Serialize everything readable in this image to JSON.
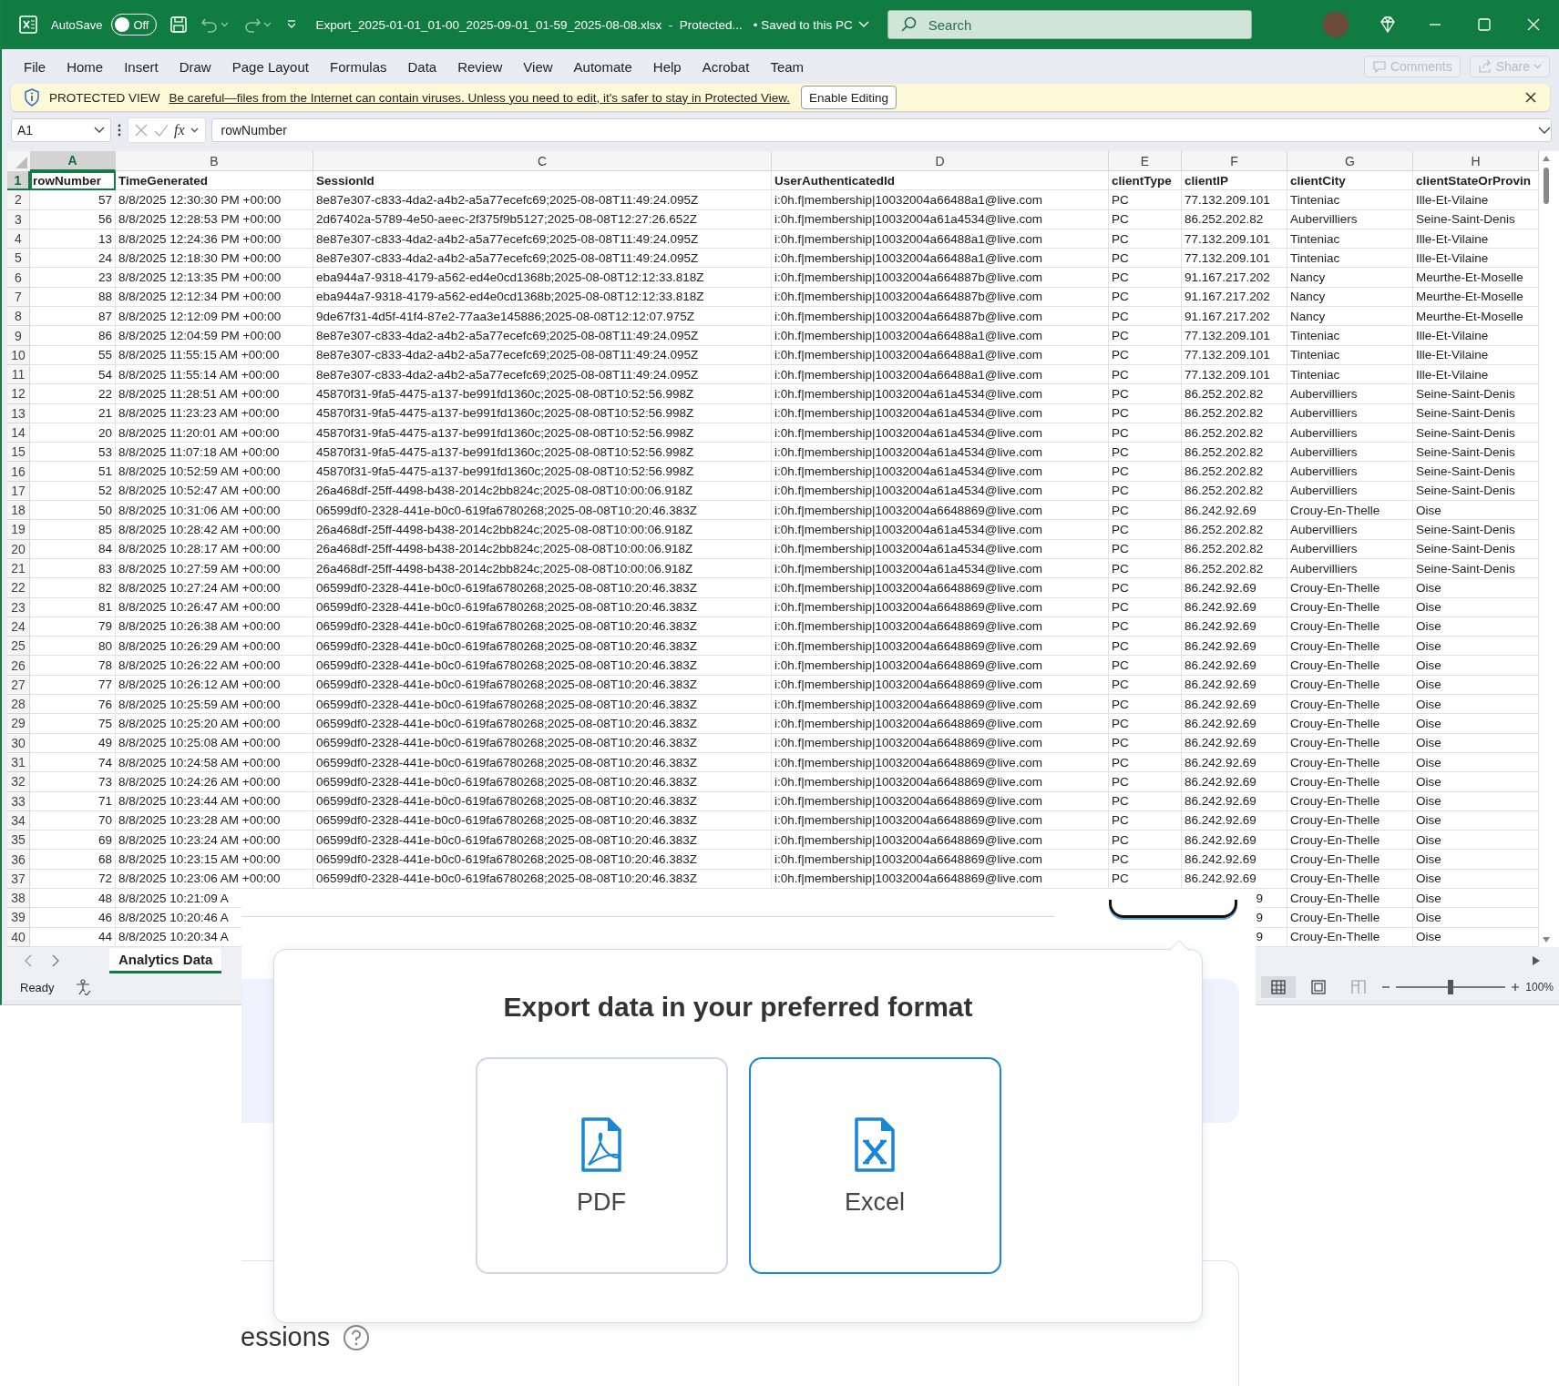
{
  "title_bar": {
    "autosave_label": "AutoSave",
    "autosave": {
      "on": false,
      "label": "Off"
    },
    "file_title": "Export_2025-01-01_01-00_2025-09-01_01-59_2025-08-08.xlsx  -  Protected...",
    "save_status": "• Saved to this PC",
    "search": {
      "placeholder": "Search"
    }
  },
  "menu": [
    "File",
    "Home",
    "Insert",
    "Draw",
    "Page Layout",
    "Formulas",
    "Data",
    "Review",
    "View",
    "Automate",
    "Help",
    "Acrobat",
    "Team"
  ],
  "menu_actions": [
    {
      "kind": "comments",
      "label": "Comments",
      "disabled": true
    },
    {
      "kind": "share",
      "label": "Share",
      "disabled": true
    }
  ],
  "protected_view": {
    "label": "PROTECTED VIEW",
    "message": "Be careful—files from the Internet can contain viruses. Unless you need to edit, it's safer to stay in Protected View.",
    "button": "Enable Editing"
  },
  "formula_bar": {
    "name_box": "A1",
    "function_label": "fx",
    "formula": "rowNumber"
  },
  "sheet": {
    "columns": [
      {
        "label": "A",
        "selected": true
      },
      {
        "label": "B",
        "selected": false
      },
      {
        "label": "C",
        "selected": false
      },
      {
        "label": "D",
        "selected": false
      },
      {
        "label": "E",
        "selected": false
      },
      {
        "label": "F",
        "selected": false
      },
      {
        "label": "G",
        "selected": false
      },
      {
        "label": "H",
        "selected": false
      }
    ],
    "rows": [
      {
        "number": "1",
        "selected": true,
        "cells": [
          "rowNumber",
          "TimeGenerated",
          "SessionId",
          "UserAuthenticatedId",
          "clientType",
          "clientIP",
          "clientCity",
          "clientStateOrProvin"
        ]
      },
      {
        "number": "2",
        "selected": false,
        "cells": [
          "57",
          "8/8/2025 12:30:30 PM +00:00",
          "8e87e307-c833-4da2-a4b2-a5a77ecefc69;2025-08-08T11:49:24.095Z",
          "i:0h.f|membership|10032004a66488a1@live.com",
          "PC",
          "77.132.209.101",
          "Tinteniac",
          "Ille-Et-Vilaine"
        ]
      },
      {
        "number": "3",
        "selected": false,
        "cells": [
          "56",
          "8/8/2025 12:28:53 PM +00:00",
          "2d67402a-5789-4e50-aeec-2f375f9b5127;2025-08-08T12:27:26.652Z",
          "i:0h.f|membership|10032004a61a4534@live.com",
          "PC",
          "86.252.202.82",
          "Aubervilliers",
          "Seine-Saint-Denis"
        ]
      },
      {
        "number": "4",
        "selected": false,
        "cells": [
          "13",
          "8/8/2025 12:24:36 PM +00:00",
          "8e87e307-c833-4da2-a4b2-a5a77ecefc69;2025-08-08T11:49:24.095Z",
          "i:0h.f|membership|10032004a66488a1@live.com",
          "PC",
          "77.132.209.101",
          "Tinteniac",
          "Ille-Et-Vilaine"
        ]
      },
      {
        "number": "5",
        "selected": false,
        "cells": [
          "24",
          "8/8/2025 12:18:30 PM +00:00",
          "8e87e307-c833-4da2-a4b2-a5a77ecefc69;2025-08-08T11:49:24.095Z",
          "i:0h.f|membership|10032004a66488a1@live.com",
          "PC",
          "77.132.209.101",
          "Tinteniac",
          "Ille-Et-Vilaine"
        ]
      },
      {
        "number": "6",
        "selected": false,
        "cells": [
          "23",
          "8/8/2025 12:13:35 PM +00:00",
          "eba944a7-9318-4179-a562-ed4e0cd1368b;2025-08-08T12:12:33.818Z",
          "i:0h.f|membership|10032004a664887b@live.com",
          "PC",
          "91.167.217.202",
          "Nancy",
          "Meurthe-Et-Moselle"
        ]
      },
      {
        "number": "7",
        "selected": false,
        "cells": [
          "88",
          "8/8/2025 12:12:34 PM +00:00",
          "eba944a7-9318-4179-a562-ed4e0cd1368b;2025-08-08T12:12:33.818Z",
          "i:0h.f|membership|10032004a664887b@live.com",
          "PC",
          "91.167.217.202",
          "Nancy",
          "Meurthe-Et-Moselle"
        ]
      },
      {
        "number": "8",
        "selected": false,
        "cells": [
          "87",
          "8/8/2025 12:12:09 PM +00:00",
          "9de67f31-4d5f-41f4-87e2-77aa3e145886;2025-08-08T12:12:07.975Z",
          "i:0h.f|membership|10032004a664887b@live.com",
          "PC",
          "91.167.217.202",
          "Nancy",
          "Meurthe-Et-Moselle"
        ]
      },
      {
        "number": "9",
        "selected": false,
        "cells": [
          "86",
          "8/8/2025 12:04:59 PM +00:00",
          "8e87e307-c833-4da2-a4b2-a5a77ecefc69;2025-08-08T11:49:24.095Z",
          "i:0h.f|membership|10032004a66488a1@live.com",
          "PC",
          "77.132.209.101",
          "Tinteniac",
          "Ille-Et-Vilaine"
        ]
      },
      {
        "number": "10",
        "selected": false,
        "cells": [
          "55",
          "8/8/2025 11:55:15 AM +00:00",
          "8e87e307-c833-4da2-a4b2-a5a77ecefc69;2025-08-08T11:49:24.095Z",
          "i:0h.f|membership|10032004a66488a1@live.com",
          "PC",
          "77.132.209.101",
          "Tinteniac",
          "Ille-Et-Vilaine"
        ]
      },
      {
        "number": "11",
        "selected": false,
        "cells": [
          "54",
          "8/8/2025 11:55:14 AM +00:00",
          "8e87e307-c833-4da2-a4b2-a5a77ecefc69;2025-08-08T11:49:24.095Z",
          "i:0h.f|membership|10032004a66488a1@live.com",
          "PC",
          "77.132.209.101",
          "Tinteniac",
          "Ille-Et-Vilaine"
        ]
      },
      {
        "number": "12",
        "selected": false,
        "cells": [
          "22",
          "8/8/2025 11:28:51 AM +00:00",
          "45870f31-9fa5-4475-a137-be991fd1360c;2025-08-08T10:52:56.998Z",
          "i:0h.f|membership|10032004a61a4534@live.com",
          "PC",
          "86.252.202.82",
          "Aubervilliers",
          "Seine-Saint-Denis"
        ]
      },
      {
        "number": "13",
        "selected": false,
        "cells": [
          "21",
          "8/8/2025 11:23:23 AM +00:00",
          "45870f31-9fa5-4475-a137-be991fd1360c;2025-08-08T10:52:56.998Z",
          "i:0h.f|membership|10032004a61a4534@live.com",
          "PC",
          "86.252.202.82",
          "Aubervilliers",
          "Seine-Saint-Denis"
        ]
      },
      {
        "number": "14",
        "selected": false,
        "cells": [
          "20",
          "8/8/2025 11:20:01 AM +00:00",
          "45870f31-9fa5-4475-a137-be991fd1360c;2025-08-08T10:52:56.998Z",
          "i:0h.f|membership|10032004a61a4534@live.com",
          "PC",
          "86.252.202.82",
          "Aubervilliers",
          "Seine-Saint-Denis"
        ]
      },
      {
        "number": "15",
        "selected": false,
        "cells": [
          "53",
          "8/8/2025 11:07:18 AM +00:00",
          "45870f31-9fa5-4475-a137-be991fd1360c;2025-08-08T10:52:56.998Z",
          "i:0h.f|membership|10032004a61a4534@live.com",
          "PC",
          "86.252.202.82",
          "Aubervilliers",
          "Seine-Saint-Denis"
        ]
      },
      {
        "number": "16",
        "selected": false,
        "cells": [
          "51",
          "8/8/2025 10:52:59 AM +00:00",
          "45870f31-9fa5-4475-a137-be991fd1360c;2025-08-08T10:52:56.998Z",
          "i:0h.f|membership|10032004a61a4534@live.com",
          "PC",
          "86.252.202.82",
          "Aubervilliers",
          "Seine-Saint-Denis"
        ]
      },
      {
        "number": "17",
        "selected": false,
        "cells": [
          "52",
          "8/8/2025 10:52:47 AM +00:00",
          "26a468df-25ff-4498-b438-2014c2bb824c;2025-08-08T10:00:06.918Z",
          "i:0h.f|membership|10032004a61a4534@live.com",
          "PC",
          "86.252.202.82",
          "Aubervilliers",
          "Seine-Saint-Denis"
        ]
      },
      {
        "number": "18",
        "selected": false,
        "cells": [
          "50",
          "8/8/2025 10:31:06 AM +00:00",
          "06599df0-2328-441e-b0c0-619fa6780268;2025-08-08T10:20:46.383Z",
          "i:0h.f|membership|10032004a6648869@live.com",
          "PC",
          "86.242.92.69",
          "Crouy-En-Thelle",
          "Oise"
        ]
      },
      {
        "number": "19",
        "selected": false,
        "cells": [
          "85",
          "8/8/2025 10:28:42 AM +00:00",
          "26a468df-25ff-4498-b438-2014c2bb824c;2025-08-08T10:00:06.918Z",
          "i:0h.f|membership|10032004a61a4534@live.com",
          "PC",
          "86.252.202.82",
          "Aubervilliers",
          "Seine-Saint-Denis"
        ]
      },
      {
        "number": "20",
        "selected": false,
        "cells": [
          "84",
          "8/8/2025 10:28:17 AM +00:00",
          "26a468df-25ff-4498-b438-2014c2bb824c;2025-08-08T10:00:06.918Z",
          "i:0h.f|membership|10032004a61a4534@live.com",
          "PC",
          "86.252.202.82",
          "Aubervilliers",
          "Seine-Saint-Denis"
        ]
      },
      {
        "number": "21",
        "selected": false,
        "cells": [
          "83",
          "8/8/2025 10:27:59 AM +00:00",
          "26a468df-25ff-4498-b438-2014c2bb824c;2025-08-08T10:00:06.918Z",
          "i:0h.f|membership|10032004a61a4534@live.com",
          "PC",
          "86.252.202.82",
          "Aubervilliers",
          "Seine-Saint-Denis"
        ]
      },
      {
        "number": "22",
        "selected": false,
        "cells": [
          "82",
          "8/8/2025 10:27:24 AM +00:00",
          "06599df0-2328-441e-b0c0-619fa6780268;2025-08-08T10:20:46.383Z",
          "i:0h.f|membership|10032004a6648869@live.com",
          "PC",
          "86.242.92.69",
          "Crouy-En-Thelle",
          "Oise"
        ]
      },
      {
        "number": "23",
        "selected": false,
        "cells": [
          "81",
          "8/8/2025 10:26:47 AM +00:00",
          "06599df0-2328-441e-b0c0-619fa6780268;2025-08-08T10:20:46.383Z",
          "i:0h.f|membership|10032004a6648869@live.com",
          "PC",
          "86.242.92.69",
          "Crouy-En-Thelle",
          "Oise"
        ]
      },
      {
        "number": "24",
        "selected": false,
        "cells": [
          "79",
          "8/8/2025 10:26:38 AM +00:00",
          "06599df0-2328-441e-b0c0-619fa6780268;2025-08-08T10:20:46.383Z",
          "i:0h.f|membership|10032004a6648869@live.com",
          "PC",
          "86.242.92.69",
          "Crouy-En-Thelle",
          "Oise"
        ]
      },
      {
        "number": "25",
        "selected": false,
        "cells": [
          "80",
          "8/8/2025 10:26:29 AM +00:00",
          "06599df0-2328-441e-b0c0-619fa6780268;2025-08-08T10:20:46.383Z",
          "i:0h.f|membership|10032004a6648869@live.com",
          "PC",
          "86.242.92.69",
          "Crouy-En-Thelle",
          "Oise"
        ]
      },
      {
        "number": "26",
        "selected": false,
        "cells": [
          "78",
          "8/8/2025 10:26:22 AM +00:00",
          "06599df0-2328-441e-b0c0-619fa6780268;2025-08-08T10:20:46.383Z",
          "i:0h.f|membership|10032004a6648869@live.com",
          "PC",
          "86.242.92.69",
          "Crouy-En-Thelle",
          "Oise"
        ]
      },
      {
        "number": "27",
        "selected": false,
        "cells": [
          "77",
          "8/8/2025 10:26:12 AM +00:00",
          "06599df0-2328-441e-b0c0-619fa6780268;2025-08-08T10:20:46.383Z",
          "i:0h.f|membership|10032004a6648869@live.com",
          "PC",
          "86.242.92.69",
          "Crouy-En-Thelle",
          "Oise"
        ]
      },
      {
        "number": "28",
        "selected": false,
        "cells": [
          "76",
          "8/8/2025 10:25:59 AM +00:00",
          "06599df0-2328-441e-b0c0-619fa6780268;2025-08-08T10:20:46.383Z",
          "i:0h.f|membership|10032004a6648869@live.com",
          "PC",
          "86.242.92.69",
          "Crouy-En-Thelle",
          "Oise"
        ]
      },
      {
        "number": "29",
        "selected": false,
        "cells": [
          "75",
          "8/8/2025 10:25:20 AM +00:00",
          "06599df0-2328-441e-b0c0-619fa6780268;2025-08-08T10:20:46.383Z",
          "i:0h.f|membership|10032004a6648869@live.com",
          "PC",
          "86.242.92.69",
          "Crouy-En-Thelle",
          "Oise"
        ]
      },
      {
        "number": "30",
        "selected": false,
        "cells": [
          "49",
          "8/8/2025 10:25:08 AM +00:00",
          "06599df0-2328-441e-b0c0-619fa6780268;2025-08-08T10:20:46.383Z",
          "i:0h.f|membership|10032004a6648869@live.com",
          "PC",
          "86.242.92.69",
          "Crouy-En-Thelle",
          "Oise"
        ]
      },
      {
        "number": "31",
        "selected": false,
        "cells": [
          "74",
          "8/8/2025 10:24:58 AM +00:00",
          "06599df0-2328-441e-b0c0-619fa6780268;2025-08-08T10:20:46.383Z",
          "i:0h.f|membership|10032004a6648869@live.com",
          "PC",
          "86.242.92.69",
          "Crouy-En-Thelle",
          "Oise"
        ]
      },
      {
        "number": "32",
        "selected": false,
        "cells": [
          "73",
          "8/8/2025 10:24:26 AM +00:00",
          "06599df0-2328-441e-b0c0-619fa6780268;2025-08-08T10:20:46.383Z",
          "i:0h.f|membership|10032004a6648869@live.com",
          "PC",
          "86.242.92.69",
          "Crouy-En-Thelle",
          "Oise"
        ]
      },
      {
        "number": "33",
        "selected": false,
        "cells": [
          "71",
          "8/8/2025 10:23:44 AM +00:00",
          "06599df0-2328-441e-b0c0-619fa6780268;2025-08-08T10:20:46.383Z",
          "i:0h.f|membership|10032004a6648869@live.com",
          "PC",
          "86.242.92.69",
          "Crouy-En-Thelle",
          "Oise"
        ]
      },
      {
        "number": "34",
        "selected": false,
        "cells": [
          "70",
          "8/8/2025 10:23:28 AM +00:00",
          "06599df0-2328-441e-b0c0-619fa6780268;2025-08-08T10:20:46.383Z",
          "i:0h.f|membership|10032004a6648869@live.com",
          "PC",
          "86.242.92.69",
          "Crouy-En-Thelle",
          "Oise"
        ]
      },
      {
        "number": "35",
        "selected": false,
        "cells": [
          "69",
          "8/8/2025 10:23:24 AM +00:00",
          "06599df0-2328-441e-b0c0-619fa6780268;2025-08-08T10:20:46.383Z",
          "i:0h.f|membership|10032004a6648869@live.com",
          "PC",
          "86.242.92.69",
          "Crouy-En-Thelle",
          "Oise"
        ]
      },
      {
        "number": "36",
        "selected": false,
        "cells": [
          "68",
          "8/8/2025 10:23:15 AM +00:00",
          "06599df0-2328-441e-b0c0-619fa6780268;2025-08-08T10:20:46.383Z",
          "i:0h.f|membership|10032004a6648869@live.com",
          "PC",
          "86.242.92.69",
          "Crouy-En-Thelle",
          "Oise"
        ]
      },
      {
        "number": "37",
        "selected": false,
        "cells": [
          "72",
          "8/8/2025 10:23:06 AM +00:00",
          "06599df0-2328-441e-b0c0-619fa6780268;2025-08-08T10:20:46.383Z",
          "i:0h.f|membership|10032004a6648869@live.com",
          "PC",
          "86.242.92.69",
          "Crouy-En-Thelle",
          "Oise"
        ]
      },
      {
        "number": "38",
        "selected": false,
        "cells": [
          "48",
          "8/8/2025 10:21:09 A",
          null,
          null,
          null,
          "9",
          "Crouy-En-Thelle",
          "Oise"
        ]
      },
      {
        "number": "39",
        "selected": false,
        "cells": [
          "46",
          "8/8/2025 10:20:46 A",
          null,
          null,
          null,
          "9",
          "Crouy-En-Thelle",
          "Oise"
        ]
      },
      {
        "number": "40",
        "selected": false,
        "cells": [
          "44",
          "8/8/2025 10:20:34 A",
          null,
          null,
          null,
          "9",
          "Crouy-En-Thelle",
          "Oise"
        ]
      }
    ]
  },
  "sheet_tabs": [
    {
      "label": "Analytics Data",
      "selected": true
    }
  ],
  "status_bar": {
    "status": "Ready",
    "views": [
      {
        "kind": "normal",
        "selected": true
      },
      {
        "kind": "page_layout",
        "selected": false
      },
      {
        "kind": "page_break",
        "selected": false
      }
    ],
    "zoom_slider": {
      "level": 0.5
    },
    "zoom": "100%"
  },
  "export_dialog": {
    "title": "Export data in your preferred format",
    "options": [
      {
        "kind": "pdf",
        "label": "PDF",
        "selected": false
      },
      {
        "kind": "excel",
        "label": "Excel",
        "selected": true
      }
    ]
  },
  "background_page": {
    "section_title": "essions"
  }
}
